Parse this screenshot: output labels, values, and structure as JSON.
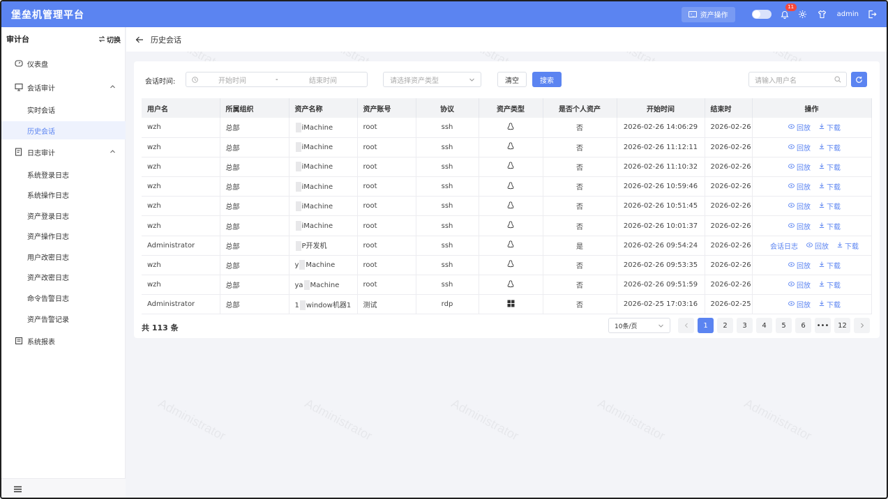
{
  "app": {
    "title": "堡垒机管理平台"
  },
  "topbar": {
    "asset_op": "资产操作",
    "notif_count": "11",
    "user": "admin"
  },
  "sidebar": {
    "title": "审计台",
    "switch": "切换",
    "menu": {
      "dashboard": "仪表盘",
      "session_audit": "会话审计",
      "realtime": "实时会话",
      "history": "历史会话",
      "log_audit": "日志审计",
      "logs": [
        "系统登录日志",
        "系统操作日志",
        "资产登录日志",
        "资产操作日志",
        "用户改密日志",
        "资产改密日志",
        "命令告警日志",
        "资产告警记录"
      ],
      "reports": "系统报表"
    }
  },
  "breadcrumb": {
    "title": "历史会话"
  },
  "filters": {
    "time_label": "会话时间:",
    "start_placeholder": "开始时间",
    "range_sep": "-",
    "end_placeholder": "结束时间",
    "type_placeholder": "请选择资产类型",
    "clear": "清空",
    "search": "搜索",
    "user_placeholder": "请输入用户名"
  },
  "table": {
    "headers": [
      "用户名",
      "所属组织",
      "资产名称",
      "资产账号",
      "协议",
      "资产类型",
      "是否个人资产",
      "开始时间",
      "结束时",
      "操作"
    ],
    "rows": [
      {
        "user": "wzh",
        "org": "总部",
        "asset_pre": "",
        "asset": "iMachine",
        "account": "root",
        "proto": "ssh",
        "type": "linux",
        "personal": "否",
        "start": "2026-02-26 14:06:29",
        "end": "2026-02-26",
        "ops": [
          "回放",
          "下载"
        ]
      },
      {
        "user": "wzh",
        "org": "总部",
        "asset_pre": "",
        "asset": "iMachine",
        "account": "root",
        "proto": "ssh",
        "type": "linux",
        "personal": "否",
        "start": "2026-02-26 11:12:11",
        "end": "2026-02-26",
        "ops": [
          "回放",
          "下载"
        ]
      },
      {
        "user": "wzh",
        "org": "总部",
        "asset_pre": "",
        "asset": "iMachine",
        "account": "root",
        "proto": "ssh",
        "type": "linux",
        "personal": "否",
        "start": "2026-02-26 11:10:32",
        "end": "2026-02-26",
        "ops": [
          "回放",
          "下载"
        ]
      },
      {
        "user": "wzh",
        "org": "总部",
        "asset_pre": "",
        "asset": "iMachine",
        "account": "root",
        "proto": "ssh",
        "type": "linux",
        "personal": "否",
        "start": "2026-02-26 10:59:46",
        "end": "2026-02-26",
        "ops": [
          "回放",
          "下载"
        ]
      },
      {
        "user": "wzh",
        "org": "总部",
        "asset_pre": "",
        "asset": "iMachine",
        "account": "root",
        "proto": "ssh",
        "type": "linux",
        "personal": "否",
        "start": "2026-02-26 10:51:45",
        "end": "2026-02-26",
        "ops": [
          "回放",
          "下载"
        ]
      },
      {
        "user": "wzh",
        "org": "总部",
        "asset_pre": "",
        "asset": "iMachine",
        "account": "root",
        "proto": "ssh",
        "type": "linux",
        "personal": "否",
        "start": "2026-02-26 10:01:37",
        "end": "2026-02-26",
        "ops": [
          "回放",
          "下载"
        ]
      },
      {
        "user": "Administrator",
        "org": "总部",
        "asset_pre": "",
        "asset": "P开发机",
        "account": "root",
        "proto": "ssh",
        "type": "linux",
        "personal": "是",
        "start": "2026-02-26 09:54:24",
        "end": "2026-02-26",
        "ops": [
          "会话日志",
          "回放",
          "下载"
        ]
      },
      {
        "user": "wzh",
        "org": "总部",
        "asset_pre": "y",
        "asset": "Machine",
        "account": "root",
        "proto": "ssh",
        "type": "linux",
        "personal": "否",
        "start": "2026-02-26 09:53:35",
        "end": "2026-02-26",
        "ops": [
          "回放",
          "下载"
        ]
      },
      {
        "user": "wzh",
        "org": "总部",
        "asset_pre": "ya",
        "asset": "Machine",
        "account": "root",
        "proto": "ssh",
        "type": "linux",
        "personal": "否",
        "start": "2026-02-26 09:51:59",
        "end": "2026-02-26",
        "ops": [
          "回放",
          "下载"
        ]
      },
      {
        "user": "Administrator",
        "org": "总部",
        "asset_pre": "1",
        "asset": "window机器1",
        "account": "测试",
        "proto": "rdp",
        "type": "windows",
        "personal": "否",
        "start": "2026-02-25 17:03:16",
        "end": "2026-02-25",
        "ops": [
          "回放",
          "下载"
        ]
      }
    ]
  },
  "pagination": {
    "total": "共 113 条",
    "page_size": "10条/页",
    "pages": [
      "1",
      "2",
      "3",
      "4",
      "5",
      "6",
      "•••",
      "12"
    ],
    "current": "1"
  },
  "watermark": "Administrator",
  "colors": {
    "primary": "#5b84f1",
    "badge": "#f5483b"
  }
}
